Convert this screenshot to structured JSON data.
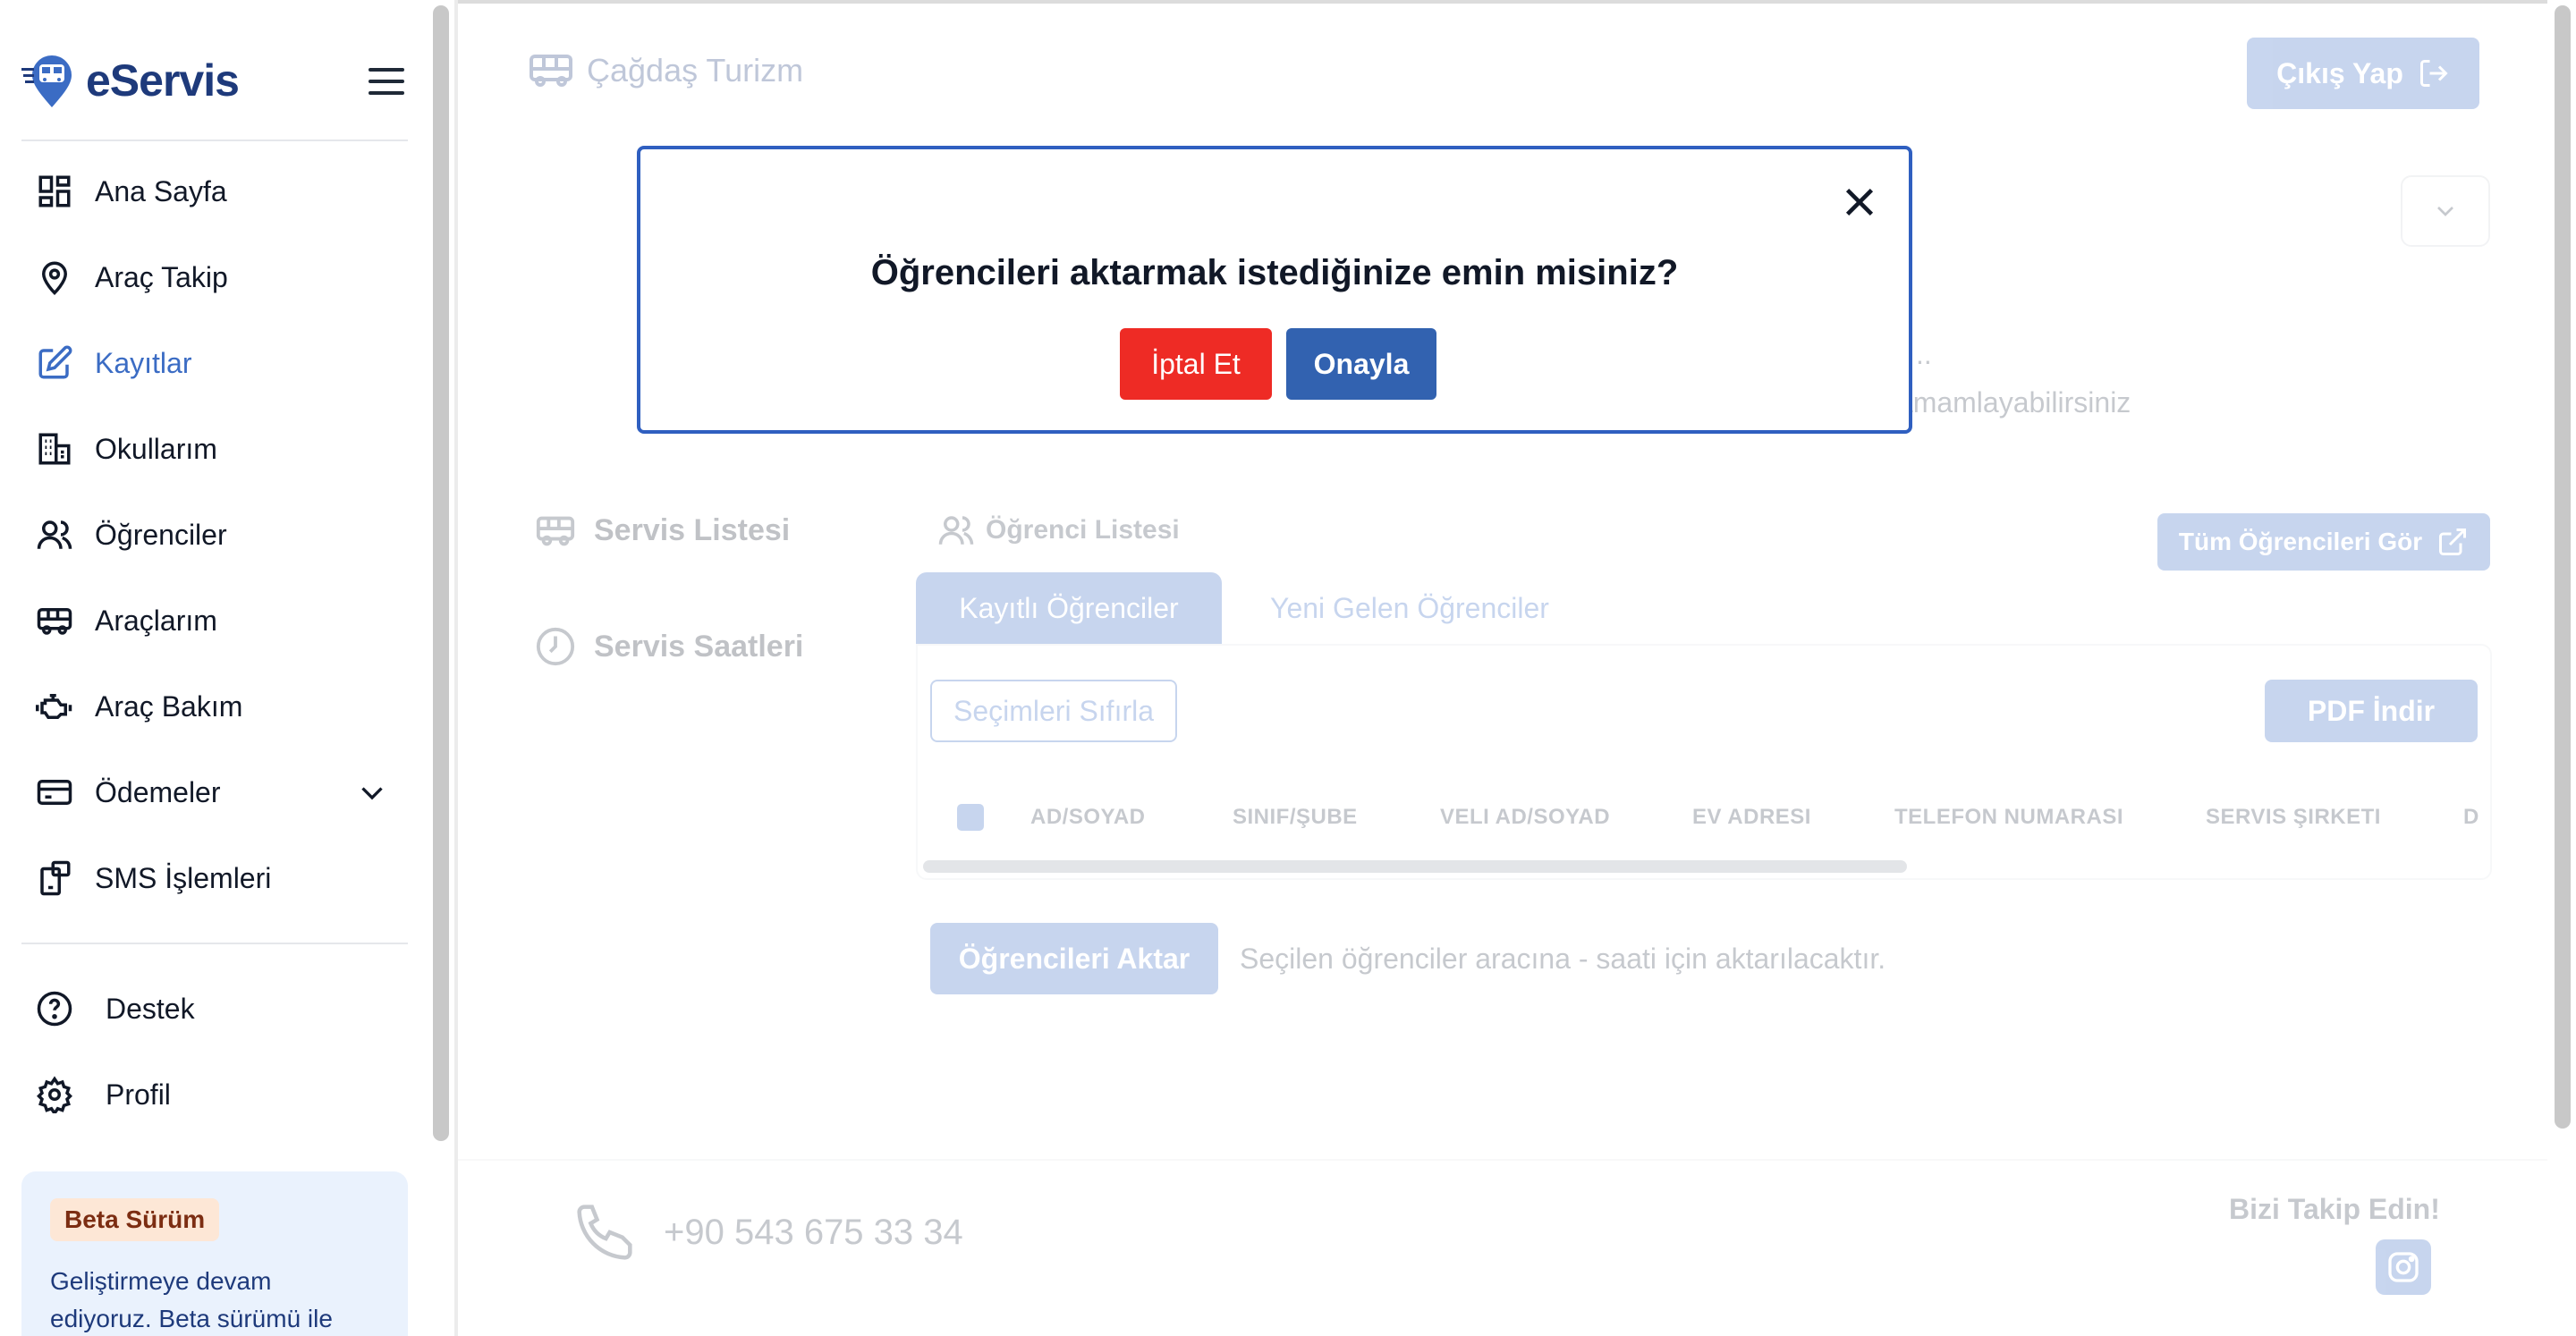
{
  "app": {
    "brand": "eServis"
  },
  "sidebar": {
    "items": [
      {
        "label": "Ana Sayfa",
        "icon": "dashboard-icon"
      },
      {
        "label": "Araç Takip",
        "icon": "location-pin-icon"
      },
      {
        "label": "Kayıtlar",
        "icon": "edit-icon",
        "active": true
      },
      {
        "label": "Okullarım",
        "icon": "building-icon"
      },
      {
        "label": "Öğrenciler",
        "icon": "users-icon"
      },
      {
        "label": "Araçlarım",
        "icon": "bus-icon"
      },
      {
        "label": "Araç Bakım",
        "icon": "engine-icon"
      },
      {
        "label": "Ödemeler",
        "icon": "credit-card-icon"
      },
      {
        "label": "SMS İşlemleri",
        "icon": "sms-icon"
      }
    ],
    "bottom_items": [
      {
        "label": "Destek",
        "icon": "help-circle-icon"
      },
      {
        "label": "Profil",
        "icon": "gear-icon"
      }
    ],
    "beta": {
      "badge": "Beta Sürüm",
      "text": "Geliştirmeye devam ediyoruz. Beta sürümü ile"
    }
  },
  "header": {
    "company": "Çağdaş Turizm",
    "logout_label": "Çıkış Yap"
  },
  "main": {
    "dots": "..",
    "hint": "tamamlayabilirsiniz",
    "side_tabs": [
      "Servis Listesi",
      "Servis Saatleri"
    ],
    "list_title": "Öğrenci Listesi",
    "all_students_label": "Tüm Öğrencileri Gör",
    "tabs": [
      "Kayıtlı Öğrenciler",
      "Yeni Gelen Öğrenciler"
    ],
    "reset_label": "Seçimleri Sıfırla",
    "pdf_label": "PDF İndir",
    "columns": [
      "AD/SOYAD",
      "SINIF/ŞUBE",
      "VELI AD/SOYAD",
      "EV ADRESI",
      "TELEFON NUMARASI",
      "SERVIS ŞIRKETI",
      "D"
    ],
    "transfer_label": "Öğrencileri Aktar",
    "transfer_note": "Seçilen öğrenciler aracına - saati için aktarılacaktır."
  },
  "footer": {
    "phone": "+90 543 675 33 34",
    "follow": "Bizi Takip Edin!"
  },
  "modal": {
    "title": "Öğrencileri aktarmak istediğinize emin misiniz?",
    "cancel_label": "İptal Et",
    "confirm_label": "Onayla"
  },
  "colors": {
    "primary": "#3b6cc4",
    "danger": "#ee2b25",
    "brand_dark": "#1e3a7b"
  }
}
